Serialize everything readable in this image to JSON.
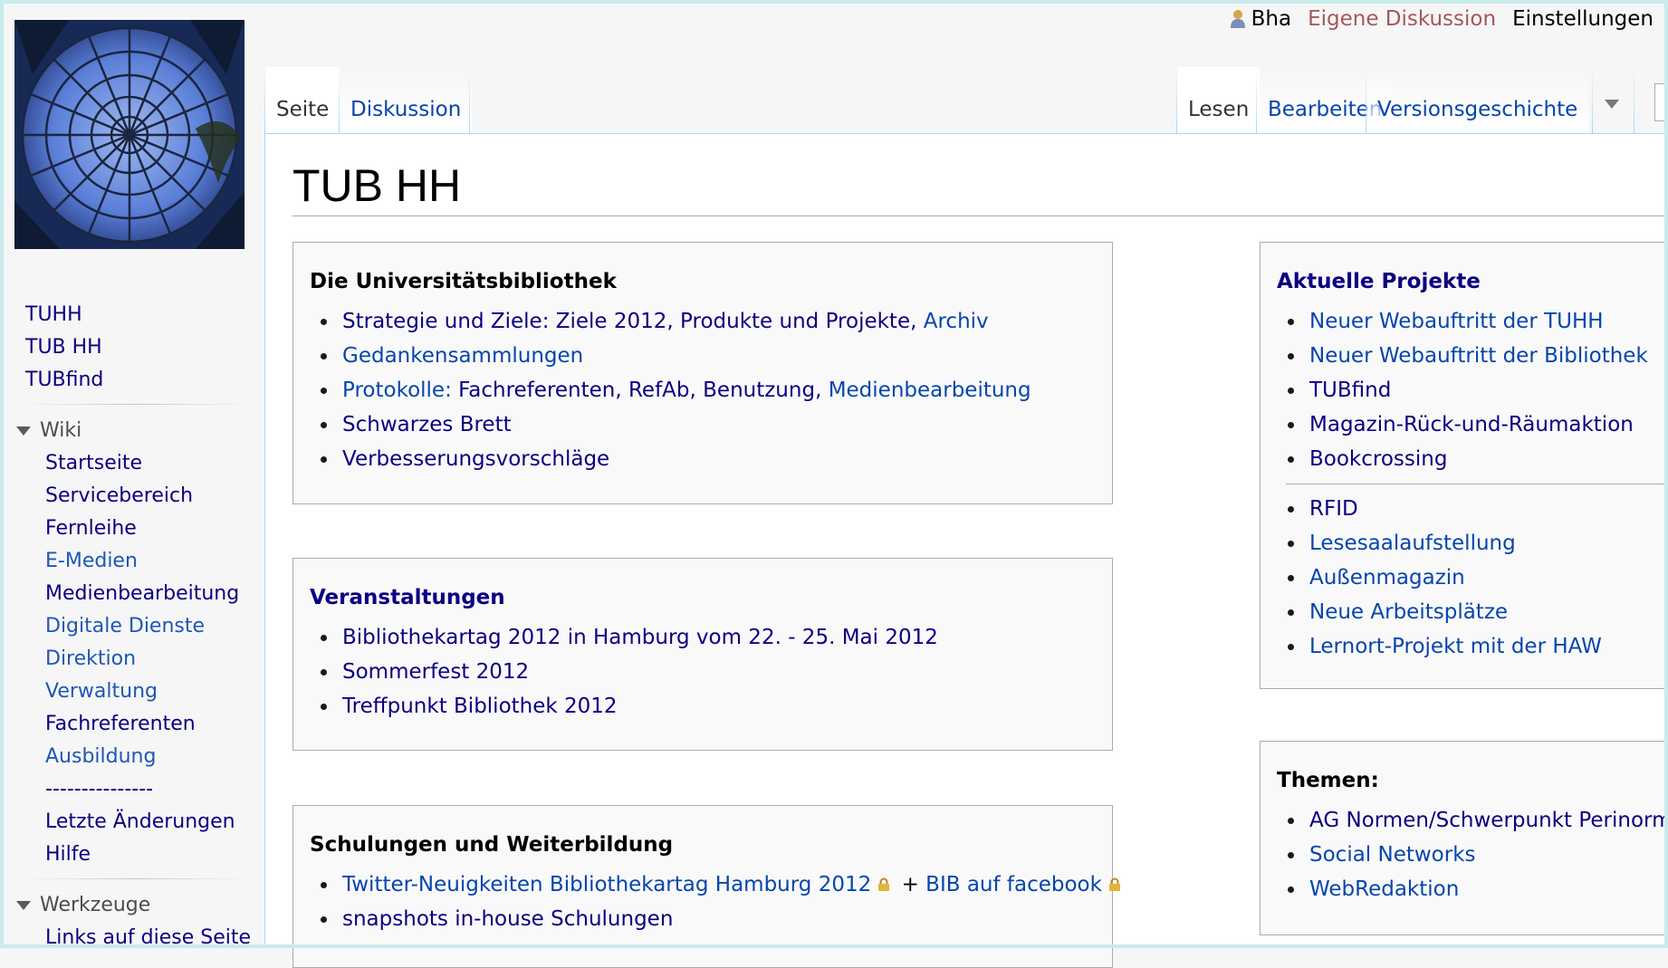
{
  "personal": {
    "user": "Bha",
    "talk": "Eigene Diskussion",
    "prefs": "Einstellungen"
  },
  "tabs": {
    "page": "Seite",
    "discussion": "Diskussion",
    "read": "Lesen",
    "edit": "Bearbeiten",
    "history": "Versionsgeschichte"
  },
  "sidebar": {
    "top_links": [
      "TUHH",
      "TUB HH",
      "TUBfind"
    ],
    "wiki_heading": "Wiki",
    "wiki_links": [
      "Startseite",
      "Servicebereich",
      "Fernleihe",
      "E-Medien",
      "Medienbearbeitung",
      "Digitale Dienste",
      "Direktion",
      "Verwaltung",
      "Fachreferenten",
      "Ausbildung",
      "---------------",
      "Letzte Änderungen",
      "Hilfe"
    ],
    "tools_heading": "Werkzeuge",
    "tools_links": [
      "Links auf diese Seite"
    ]
  },
  "page": {
    "title": "TUB HH"
  },
  "box_uni": {
    "heading": "Die Universitätsbibliothek",
    "item1": {
      "t1": "Strategie und Ziele: Ziele 2012, Produkte und Projekte, ",
      "t2": "Archiv"
    },
    "item2": "Gedankensammlungen",
    "item3": {
      "t1": "Protokolle:",
      "t2": " Fachreferenten, RefAb, Benutzung, ",
      "t3": "Medienbearbeitung"
    },
    "item4": "Schwarzes Brett",
    "item5": "Verbesserungsvorschläge"
  },
  "box_events": {
    "heading": "Veranstaltungen",
    "items": [
      "Bibliothekartag 2012 in Hamburg vom 22. - 25. Mai 2012",
      "Sommerfest 2012",
      "Treffpunkt Bibliothek 2012"
    ]
  },
  "box_training": {
    "heading": "Schulungen und Weiterbildung",
    "item1": {
      "t1": "Twitter-Neuigkeiten Bibliothekartag Hamburg 2012",
      "t2": " + ",
      "t3": "BIB auf facebook"
    },
    "item2": "snapshots in-house Schulungen"
  },
  "box_projects": {
    "heading": "Aktuelle Projekte",
    "group1": [
      "Neuer Webauftritt der TUHH",
      "Neuer Webauftritt der Bibliothek",
      "TUBfind",
      "Magazin-Rück-und-Räumaktion",
      "Bookcrossing"
    ],
    "group2": [
      "RFID",
      "Lesesaalaufstellung",
      "Außenmagazin",
      "Neue Arbeitsplätze",
      "Lernort-Projekt mit der HAW"
    ]
  },
  "box_topics": {
    "heading": "Themen:",
    "items": [
      "AG Normen/Schwerpunkt Perinorm",
      "Social Networks",
      "WebRedaktion"
    ]
  }
}
